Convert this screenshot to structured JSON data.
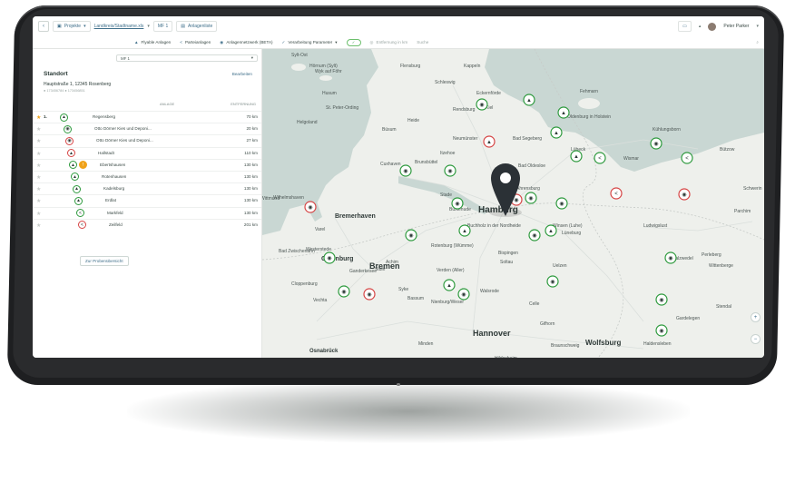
{
  "topbar": {
    "back_icon": "chevron-left-icon",
    "crumb1": "Projekte",
    "crumb2": "Landkreis/Stadtname.xls",
    "crumb3": "MF 1",
    "crumb4": "Anlagenliste",
    "user_name": "Peter Parker"
  },
  "toolbar": {
    "items": [
      "Flyable Anlagen",
      "Parteianlagen",
      "Anlagennetzwerk (BETA)",
      "Verarbeitung Parameter"
    ],
    "toggle": "✓",
    "distance_label": "Entfernung in km",
    "search_label": "Suche"
  },
  "sidebar": {
    "select_value": "MF 1",
    "title": "Standort",
    "edit_link": "Bearbeiten",
    "address": "Hauptstraße 1, 12345 Rosenberg",
    "coords": "● 173456784   ● 173456851",
    "col_name": "ANLAGE",
    "col_dist": "ENTFERNUNG",
    "rows": [
      {
        "num": "1.",
        "name": "Regensberg",
        "dist": "70 km",
        "star": true,
        "pin": "green",
        "icon": "▲"
      },
      {
        "num": "",
        "name": "Otto Dörner Kies und Deponi...",
        "dist": "20 km",
        "star": false,
        "pin": "green",
        "icon": "◉"
      },
      {
        "num": "",
        "name": "Otto Dörner Kies und Deponi...",
        "dist": "27 km",
        "star": false,
        "pin": "red",
        "icon": "◉"
      },
      {
        "num": "",
        "name": "Hallstadt",
        "dist": "110 km",
        "star": false,
        "pin": "red",
        "icon": "▲"
      },
      {
        "num": "",
        "name": "Ebertshausen",
        "dist": "130 km",
        "star": false,
        "pin": "green",
        "icon": "▲"
      },
      {
        "num": "",
        "name": "Rotenhausen",
        "dist": "130 km",
        "star": false,
        "pin": "green",
        "icon": "▲"
      },
      {
        "num": "",
        "name": "Kadelsburg",
        "dist": "130 km",
        "star": false,
        "pin": "green",
        "icon": "▲"
      },
      {
        "num": "",
        "name": "Erdlat",
        "dist": "130 km",
        "star": false,
        "pin": "green",
        "icon": "▲"
      },
      {
        "num": "",
        "name": "Markfeld",
        "dist": "130 km",
        "star": false,
        "pin": "green",
        "icon": "<"
      },
      {
        "num": "",
        "name": "Zeilfeld",
        "dist": "201 km",
        "star": false,
        "pin": "red",
        "icon": "<"
      }
    ],
    "probe_button": "Zur Probenübersicht"
  },
  "map": {
    "cities_large": [
      "Hamburg",
      "Bremen",
      "Hannover",
      "Bremerhaven",
      "Oldenburg",
      "Wolfsburg",
      "Osnabrück"
    ],
    "labels": [
      {
        "t": "Flensburg"
      },
      {
        "t": "Husum"
      },
      {
        "t": "Schleswig"
      },
      {
        "t": "Kappeln"
      },
      {
        "t": "Eckernförde"
      },
      {
        "t": "Kiel"
      },
      {
        "t": "Rendsburg"
      },
      {
        "t": "Heide"
      },
      {
        "t": "Neumünster"
      },
      {
        "t": "Fehmarn"
      },
      {
        "t": "Oldenburg in Holstein"
      },
      {
        "t": "Lübeck"
      },
      {
        "t": "Wismar"
      },
      {
        "t": "Bad Segeberg"
      },
      {
        "t": "Bad Oldesloe"
      },
      {
        "t": "Itzehoe"
      },
      {
        "t": "Brunsbüttel"
      },
      {
        "t": "Cuxhaven"
      },
      {
        "t": "Stade"
      },
      {
        "t": "Buxtehude"
      },
      {
        "t": "Ahrensburg"
      },
      {
        "t": "Schwerin"
      },
      {
        "t": "Parchim"
      },
      {
        "t": "Buchholz in der Nordheide"
      },
      {
        "t": "Winsen (Luhe)"
      },
      {
        "t": "Lüneburg"
      },
      {
        "t": "Ludwigslust"
      },
      {
        "t": "Rotenburg (Wümme)"
      },
      {
        "t": "Verden (Aller)"
      },
      {
        "t": "Soltau"
      },
      {
        "t": "Uelzen"
      },
      {
        "t": "Celle"
      },
      {
        "t": "Gifhorn"
      },
      {
        "t": "Nienburg/Weser"
      },
      {
        "t": "Salzwedel"
      },
      {
        "t": "Stendal"
      },
      {
        "t": "Gardelegen"
      },
      {
        "t": "Helgoland"
      },
      {
        "t": "Wilhelmshaven"
      },
      {
        "t": "Varel"
      },
      {
        "t": "Cloppenburg"
      },
      {
        "t": "Vechta"
      },
      {
        "t": "Braunschweig"
      },
      {
        "t": "Minden"
      },
      {
        "t": "Hildesheim"
      },
      {
        "t": "Perleberg"
      },
      {
        "t": "Wittenberge"
      },
      {
        "t": "Haldensleben"
      },
      {
        "t": "Achim"
      },
      {
        "t": "Bispingen"
      },
      {
        "t": "Sylt-Ost"
      },
      {
        "t": "Wyk auf Föhr"
      },
      {
        "t": "Hörnum (Sylt)"
      },
      {
        "t": "St. Peter-Ording"
      },
      {
        "t": "Büsum"
      },
      {
        "t": "Kühlungsborn"
      },
      {
        "t": "Bützow"
      },
      {
        "t": "Wittmund"
      },
      {
        "t": "Westerstede"
      },
      {
        "t": "Bad Zwischenahn"
      },
      {
        "t": "Syke"
      },
      {
        "t": "Stuhr"
      },
      {
        "t": "Ganderkesee"
      },
      {
        "t": "Bassum"
      },
      {
        "t": "Walsrode"
      }
    ],
    "zoom_in": "+",
    "zoom_out": "−"
  },
  "colors": {
    "green": "#2e9a3e",
    "red": "#d64545",
    "water": "#c9d7d3",
    "land": "#eef0ec",
    "accent": "#3f6f8a"
  }
}
